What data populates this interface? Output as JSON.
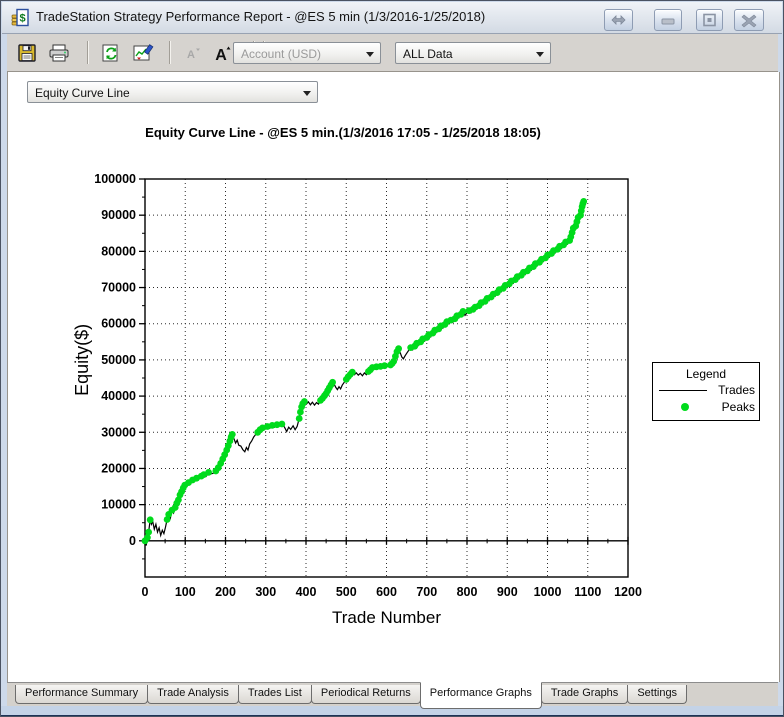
{
  "window": {
    "title": "TradeStation Strategy Performance Report - @ES 5 min (1/3/2016-1/25/2018)"
  },
  "toolbar": {
    "account_dropdown": "Account (USD)",
    "range_dropdown": "ALL Data",
    "icons": [
      "save-icon",
      "print-icon",
      "refresh-icon",
      "export-chart-icon",
      "decrease-font-icon",
      "increase-font-icon"
    ]
  },
  "report_selector": "Equity Curve Line",
  "tabs": [
    "Performance Summary",
    "Trade Analysis",
    "Trades List",
    "Periodical Returns",
    "Performance Graphs",
    "Trade Graphs",
    "Settings"
  ],
  "active_tab": "Performance Graphs",
  "chart_data": {
    "type": "line",
    "title": "Equity Curve Line - @ES 5 min.(1/3/2016 17:05 - 1/25/2018 18:05)",
    "xlabel": "Trade Number",
    "ylabel": "Equity($)",
    "xlim": [
      0,
      1200
    ],
    "ylim": [
      -10000,
      100000
    ],
    "x_ticks": [
      0,
      100,
      200,
      300,
      400,
      500,
      600,
      700,
      800,
      900,
      1000,
      1100,
      1200
    ],
    "x_minor_step": 50,
    "y_ticks": [
      0,
      10000,
      20000,
      30000,
      40000,
      50000,
      60000,
      70000,
      80000,
      90000,
      100000
    ],
    "y_minor_step": 5000,
    "grid": "dotted",
    "colors": {
      "curve": "#000000",
      "peaks": "#00db1c",
      "grid": "#2b2b2b"
    },
    "legend": {
      "title": "Legend",
      "position": "right",
      "entries": [
        {
          "label": "Trades",
          "marker": "line",
          "color": "#000000"
        },
        {
          "label": "Peaks",
          "marker": "dot",
          "color": "#00db1c"
        }
      ]
    },
    "series": [
      {
        "name": "Trades",
        "type": "line",
        "color": "#000000",
        "points": [
          [
            0,
            0
          ],
          [
            3,
            -1300
          ],
          [
            6,
            900
          ],
          [
            9,
            2400
          ],
          [
            13,
            5800
          ],
          [
            16,
            4600
          ],
          [
            19,
            5500
          ],
          [
            23,
            3200
          ],
          [
            27,
            4600
          ],
          [
            31,
            2400
          ],
          [
            35,
            3600
          ],
          [
            39,
            1500
          ],
          [
            43,
            2900
          ],
          [
            47,
            2000
          ],
          [
            51,
            3800
          ],
          [
            55,
            5900
          ],
          [
            59,
            7300
          ],
          [
            63,
            6300
          ],
          [
            67,
            8500
          ],
          [
            71,
            7700
          ],
          [
            75,
            9200
          ],
          [
            79,
            10400
          ],
          [
            83,
            11300
          ],
          [
            87,
            12700
          ],
          [
            91,
            13600
          ],
          [
            95,
            14600
          ],
          [
            99,
            15400
          ],
          [
            104,
            15100
          ],
          [
            108,
            16100
          ],
          [
            113,
            15700
          ],
          [
            118,
            16800
          ],
          [
            123,
            16400
          ],
          [
            128,
            17300
          ],
          [
            134,
            17000
          ],
          [
            140,
            17900
          ],
          [
            146,
            18300
          ],
          [
            152,
            17800
          ],
          [
            158,
            18900
          ],
          [
            164,
            18500
          ],
          [
            170,
            18700
          ],
          [
            176,
            19300
          ],
          [
            182,
            20200
          ],
          [
            188,
            21400
          ],
          [
            193,
            22600
          ],
          [
            198,
            23800
          ],
          [
            203,
            25100
          ],
          [
            207,
            26300
          ],
          [
            211,
            27600
          ],
          [
            214,
            28700
          ],
          [
            217,
            29400
          ],
          [
            221,
            28200
          ],
          [
            225,
            27000
          ],
          [
            229,
            27800
          ],
          [
            233,
            26400
          ],
          [
            238,
            26200
          ],
          [
            243,
            25200
          ],
          [
            248,
            24600
          ],
          [
            252,
            25800
          ],
          [
            256,
            25100
          ],
          [
            260,
            26800
          ],
          [
            265,
            27600
          ],
          [
            270,
            28700
          ],
          [
            275,
            29400
          ],
          [
            280,
            30000
          ],
          [
            286,
            30700
          ],
          [
            292,
            31200
          ],
          [
            298,
            30800
          ],
          [
            304,
            31600
          ],
          [
            310,
            31100
          ],
          [
            316,
            31900
          ],
          [
            322,
            31400
          ],
          [
            328,
            32100
          ],
          [
            334,
            31700
          ],
          [
            340,
            32300
          ],
          [
            346,
            31500
          ],
          [
            352,
            30200
          ],
          [
            357,
            31400
          ],
          [
            362,
            30800
          ],
          [
            368,
            31800
          ],
          [
            373,
            30700
          ],
          [
            378,
            31600
          ],
          [
            383,
            33800
          ],
          [
            386,
            35600
          ],
          [
            389,
            37000
          ],
          [
            392,
            37900
          ],
          [
            396,
            38500
          ],
          [
            401,
            37800
          ],
          [
            406,
            38400
          ],
          [
            411,
            37600
          ],
          [
            416,
            38300
          ],
          [
            421,
            37500
          ],
          [
            426,
            38200
          ],
          [
            431,
            37800
          ],
          [
            436,
            38800
          ],
          [
            441,
            39400
          ],
          [
            446,
            40100
          ],
          [
            450,
            40700
          ],
          [
            454,
            41500
          ],
          [
            458,
            42300
          ],
          [
            462,
            43100
          ],
          [
            466,
            43800
          ],
          [
            470,
            43300
          ],
          [
            474,
            42400
          ],
          [
            478,
            41800
          ],
          [
            482,
            42600
          ],
          [
            486,
            42000
          ],
          [
            490,
            43000
          ],
          [
            495,
            43800
          ],
          [
            500,
            44600
          ],
          [
            505,
            45400
          ],
          [
            510,
            46000
          ],
          [
            515,
            46600
          ],
          [
            520,
            45900
          ],
          [
            525,
            46400
          ],
          [
            530,
            45800
          ],
          [
            535,
            46300
          ],
          [
            540,
            45600
          ],
          [
            545,
            46400
          ],
          [
            550,
            45900
          ],
          [
            555,
            46800
          ],
          [
            560,
            47300
          ],
          [
            565,
            47900
          ],
          [
            570,
            47500
          ],
          [
            575,
            48100
          ],
          [
            580,
            47600
          ],
          [
            585,
            48200
          ],
          [
            590,
            47800
          ],
          [
            595,
            48400
          ],
          [
            600,
            48000
          ],
          [
            605,
            48300
          ],
          [
            610,
            48600
          ],
          [
            614,
            49000
          ],
          [
            618,
            49600
          ],
          [
            622,
            51000
          ],
          [
            626,
            52300
          ],
          [
            630,
            53100
          ],
          [
            634,
            52000
          ],
          [
            638,
            50800
          ],
          [
            642,
            50300
          ],
          [
            646,
            51100
          ],
          [
            650,
            51800
          ],
          [
            655,
            52600
          ],
          [
            660,
            53400
          ],
          [
            665,
            52800
          ],
          [
            670,
            53800
          ],
          [
            675,
            54600
          ],
          [
            680,
            54000
          ],
          [
            685,
            55000
          ],
          [
            690,
            55800
          ],
          [
            695,
            55200
          ],
          [
            700,
            56200
          ],
          [
            705,
            57000
          ],
          [
            710,
            56400
          ],
          [
            715,
            57400
          ],
          [
            720,
            58200
          ],
          [
            725,
            57600
          ],
          [
            730,
            58600
          ],
          [
            735,
            59400
          ],
          [
            740,
            58800
          ],
          [
            745,
            59800
          ],
          [
            750,
            60600
          ],
          [
            755,
            60000
          ],
          [
            760,
            61000
          ],
          [
            765,
            60400
          ],
          [
            770,
            61400
          ],
          [
            775,
            62200
          ],
          [
            780,
            61600
          ],
          [
            785,
            62600
          ],
          [
            790,
            63400
          ],
          [
            795,
            62300
          ],
          [
            800,
            63000
          ],
          [
            805,
            63600
          ],
          [
            810,
            63000
          ],
          [
            815,
            64000
          ],
          [
            820,
            64600
          ],
          [
            825,
            64100
          ],
          [
            830,
            65000
          ],
          [
            835,
            65800
          ],
          [
            840,
            65200
          ],
          [
            845,
            66200
          ],
          [
            850,
            67000
          ],
          [
            855,
            66400
          ],
          [
            860,
            67400
          ],
          [
            865,
            68200
          ],
          [
            870,
            67600
          ],
          [
            875,
            68600
          ],
          [
            880,
            69400
          ],
          [
            885,
            68800
          ],
          [
            890,
            69800
          ],
          [
            895,
            70600
          ],
          [
            900,
            70000
          ],
          [
            905,
            71000
          ],
          [
            910,
            71800
          ],
          [
            915,
            71200
          ],
          [
            920,
            72200
          ],
          [
            925,
            73000
          ],
          [
            930,
            72400
          ],
          [
            935,
            73400
          ],
          [
            940,
            74200
          ],
          [
            945,
            73600
          ],
          [
            950,
            74600
          ],
          [
            955,
            75400
          ],
          [
            960,
            74800
          ],
          [
            965,
            75800
          ],
          [
            970,
            76600
          ],
          [
            975,
            76000
          ],
          [
            980,
            77000
          ],
          [
            985,
            77800
          ],
          [
            990,
            77200
          ],
          [
            995,
            78200
          ],
          [
            1000,
            79000
          ],
          [
            1005,
            78400
          ],
          [
            1010,
            79400
          ],
          [
            1015,
            80200
          ],
          [
            1020,
            79600
          ],
          [
            1025,
            80600
          ],
          [
            1030,
            81400
          ],
          [
            1035,
            80800
          ],
          [
            1040,
            81800
          ],
          [
            1045,
            82600
          ],
          [
            1050,
            82000
          ],
          [
            1055,
            83000
          ],
          [
            1058,
            84000
          ],
          [
            1061,
            85200
          ],
          [
            1064,
            86400
          ],
          [
            1067,
            85800
          ],
          [
            1070,
            87000
          ],
          [
            1073,
            88200
          ],
          [
            1076,
            89400
          ],
          [
            1079,
            88800
          ],
          [
            1082,
            90000
          ],
          [
            1084,
            91200
          ],
          [
            1086,
            92400
          ],
          [
            1088,
            93200
          ],
          [
            1090,
            93800
          ]
        ]
      },
      {
        "name": "Peaks",
        "type": "scatter",
        "color": "#00db1c",
        "derived_from": "Trades",
        "rule": "marker at every new equity high (running maximum)"
      }
    ]
  }
}
